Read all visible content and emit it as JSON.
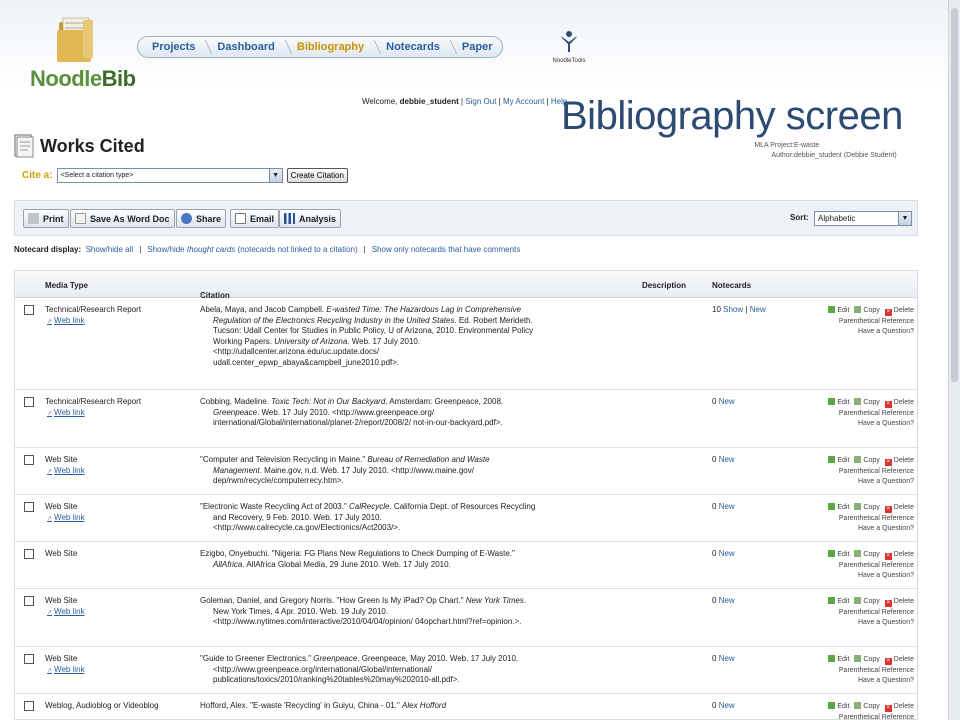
{
  "brand": {
    "logo_text": "Noodle",
    "logo_text_2": "Bib",
    "partner": "NoodleTools"
  },
  "nav": [
    {
      "label": "Projects",
      "active": false
    },
    {
      "label": "Dashboard",
      "active": false
    },
    {
      "label": "Bibliography",
      "active": true
    },
    {
      "label": "Notecards",
      "active": false
    },
    {
      "label": "Paper",
      "active": false
    }
  ],
  "account": {
    "welcome": "Welcome,",
    "user": "debbie_student",
    "sign_out": "Sign Out",
    "my_account": "My Account",
    "help": "Help"
  },
  "overlay_title": "Bibliography screen",
  "page_title": "Works Cited",
  "project": {
    "project_label": "MLA Project:",
    "project_value": "E-waste",
    "author_label": "Author:",
    "author_value": "debbie_student (Debbie Student)"
  },
  "cite": {
    "label": "Cite a:",
    "select_value": "<Select a citation type>",
    "button": "Create Citation"
  },
  "toolbar": {
    "print": "Print",
    "save_word": "Save As Word Doc",
    "share": "Share",
    "email": "Email",
    "analysis": "Analysis",
    "sort_label": "Sort:",
    "sort_value": "Alphabetic"
  },
  "notecard_display": {
    "label": "Notecard display:",
    "show_hide_all": "Show/hide all",
    "show_hide_thought_pre": "Show/hide ",
    "show_hide_thought_em": "thought cards",
    "show_hide_thought_post": " (notecards not linked to a citation)",
    "show_only_comments": "Show only notecards that have comments"
  },
  "table": {
    "headers": {
      "media_type": "Media Type",
      "citation": "Citation",
      "description": "Description",
      "notecards": "Notecards"
    },
    "actions": {
      "edit": "Edit",
      "copy": "Copy",
      "delete": "Delete",
      "parenthetical": "Parenthetical Reference",
      "question": "Have a Question?"
    },
    "web_link": "Web link",
    "rows": [
      {
        "media": "Technical/Research Report",
        "web_link": true,
        "cite_a": "Abela, Maya, and Jacob Campbell. ",
        "cite_i1": "E-wasted Time: The Hazardous Lag in Comprehensive Regulation of the Electronics Recycling Industry in the United States",
        "cite_b": ". Ed. Robert Merideth. Tucson: Udall Center for Studies in Public Policy, U of Arizona, 2010. Environmental Policy Working Papers. ",
        "cite_i2": "University of Arizona",
        "cite_c": ". Web. 17 July 2010. <http://udallcenter.arizona.edu/uc.update.docs/ udall.center_epwp_abaya&campbell_june2010.pdf>.",
        "count": "10",
        "show": "Show",
        "sep": " | ",
        "new": "New"
      },
      {
        "media": "Technical/Research Report",
        "web_link": true,
        "cite_a": "Cobbing, Madeline. ",
        "cite_i1": "Toxic Tech: Not in Our Backyard",
        "cite_b": ". Amsterdam: Greenpeace, 2008. ",
        "cite_i2": "Greenpeace",
        "cite_c": ". Web. 17 July 2010. <http://www.greenpeace.org/ international/Global/international/planet-2/report/2008/2/ not-in-our-backyard.pdf>.",
        "count": "0",
        "show": "",
        "sep": " ",
        "new": "New"
      },
      {
        "media": "Web Site",
        "web_link": true,
        "cite_a": "\"Computer and Television Recycling in Maine.\" ",
        "cite_i1": "Bureau of Remediation and Waste Management",
        "cite_b": ". Maine.gov, n.d. Web. 17 July 2010. <http://www.maine.gov/ dep/rwm/recycle/computerrecy.htm>.",
        "cite_i2": "",
        "cite_c": "",
        "count": "0",
        "show": "",
        "sep": " ",
        "new": "New"
      },
      {
        "media": "Web Site",
        "web_link": true,
        "cite_a": "\"Electronic Waste Recycling Act of 2003.\" ",
        "cite_i1": "CalRecycle",
        "cite_b": ". California Dept. of Resources Recycling and Recovery, 9 Feb. 2010. Web. 17 July 2010. <http://www.calrecycle.ca.gov/Electronics/Act2003/>.",
        "cite_i2": "",
        "cite_c": "",
        "count": "0",
        "show": "",
        "sep": " ",
        "new": "New"
      },
      {
        "media": "Web Site",
        "web_link": false,
        "cite_a": "Ezigbo, Onyebuchi. \"Nigeria: FG Plans New Regulations to Check Dumping of E-Waste.\" ",
        "cite_i1": "AllAfrica",
        "cite_b": ". AllAfrica Global Media, 29 June 2010. Web. 17 July 2010.",
        "cite_i2": "",
        "cite_c": "",
        "count": "0",
        "show": "",
        "sep": " ",
        "new": "New"
      },
      {
        "media": "Web Site",
        "web_link": true,
        "cite_a": "Goleman, Daniel, and Gregory Norris. \"How Green Is My iPad? Op Chart.\" ",
        "cite_i1": "New York Times",
        "cite_b": ". New York Times, 4 Apr. 2010. Web. 19 July 2010. <http://www.nytimes.com/interactive/2010/04/04/opinion/ 04opchart.html?ref=opinion.>.",
        "cite_i2": "",
        "cite_c": "",
        "count": "0",
        "show": "",
        "sep": " ",
        "new": "New"
      },
      {
        "media": "Web Site",
        "web_link": true,
        "cite_a": "\"Guide to Greener Electronics.\" ",
        "cite_i1": "Greenpeace",
        "cite_b": ". Greenpeace, May 2010. Web. 17 July 2010. <http://www.greenpeace.org/international/Global/international/ publications/toxics/2010/ranking%20tables%20may%202010-all.pdf>.",
        "cite_i2": "",
        "cite_c": "",
        "count": "0",
        "show": "",
        "sep": " ",
        "new": "New"
      },
      {
        "media": "Weblog, Audioblog or Videoblog",
        "web_link": false,
        "cite_a": "Hofford, Alex. \"E-waste 'Recycling' in Guiyu, China - 01.\" ",
        "cite_i1": "Alex Hofford",
        "cite_b": "",
        "cite_i2": "",
        "cite_c": "",
        "count": "0",
        "show": "",
        "sep": " ",
        "new": "New"
      }
    ]
  },
  "colors": {
    "brand_green": "#5b8f3c",
    "nav_text": "#2a5d9f",
    "nav_active": "#c99400",
    "overlay_title": "#2d4a73",
    "cite_label": "#c9a200"
  }
}
